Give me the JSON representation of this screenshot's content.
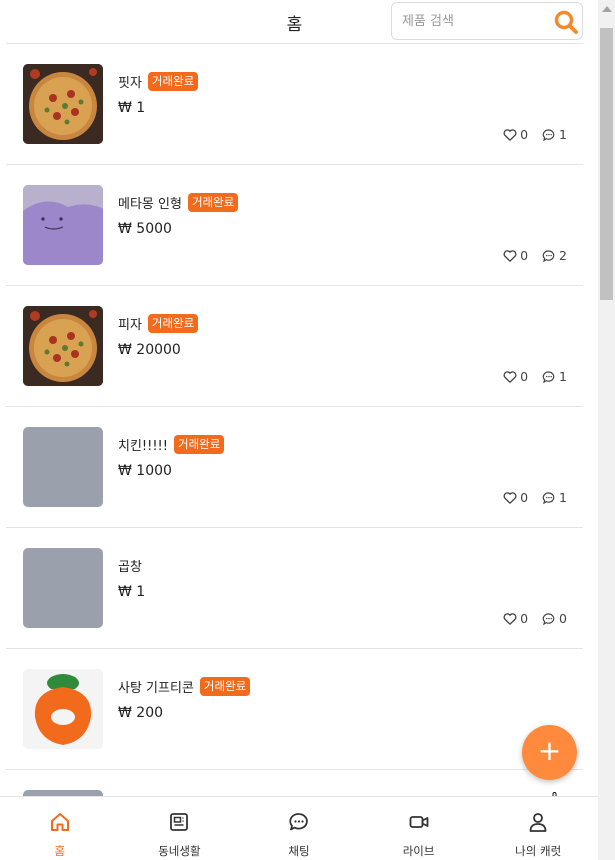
{
  "header": {
    "title": "홈",
    "search_placeholder": "제품 검색"
  },
  "colors": {
    "accent": "#f26b1d",
    "fab": "#ff8a3d",
    "badge_text": "#ffffff"
  },
  "items": [
    {
      "title": "핏자",
      "badge": "거래완료",
      "price": "₩ 1",
      "likes": "0",
      "comments": "1",
      "thumb": "pizza-photo"
    },
    {
      "title": "메타몽 인형",
      "badge": "거래완료",
      "price": "₩ 5000",
      "likes": "0",
      "comments": "2",
      "thumb": "ditto-plush-photo"
    },
    {
      "title": "피자",
      "badge": "거래완료",
      "price": "₩ 20000",
      "likes": "0",
      "comments": "1",
      "thumb": "pizza-photo"
    },
    {
      "title": "치킨!!!!!",
      "badge": "거래완료",
      "price": "₩ 1000",
      "likes": "0",
      "comments": "1",
      "thumb": "placeholder-gray"
    },
    {
      "title": "곱창",
      "badge": "",
      "price": "₩ 1",
      "likes": "0",
      "comments": "0",
      "thumb": "placeholder-gray"
    },
    {
      "title": "사탕 기프티콘",
      "badge": "거래완료",
      "price": "₩ 200",
      "likes": "",
      "comments": "",
      "thumb": "carrot-logo"
    }
  ],
  "fab": {
    "label": "+"
  },
  "bottom_nav": [
    {
      "label": "홈",
      "icon": "home-icon",
      "active": true
    },
    {
      "label": "동네생활",
      "icon": "newspaper-icon",
      "active": false
    },
    {
      "label": "채팅",
      "icon": "chat-bubble-icon",
      "active": false
    },
    {
      "label": "라이브",
      "icon": "video-camera-icon",
      "active": false
    },
    {
      "label": "나의 캐럿",
      "icon": "user-icon",
      "active": false
    }
  ]
}
